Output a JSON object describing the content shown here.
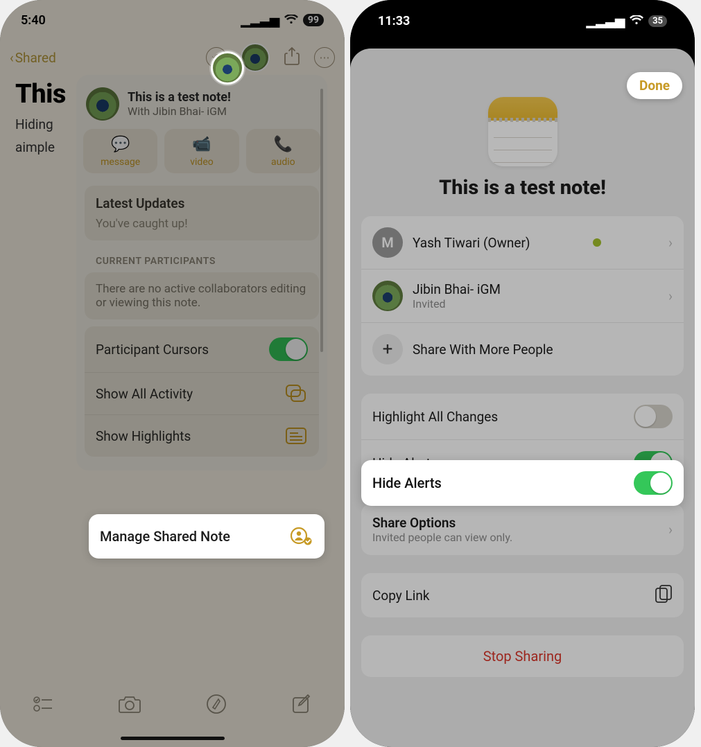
{
  "left": {
    "status": {
      "time": "5:40",
      "battery": "99"
    },
    "nav": {
      "back_label": "Shared"
    },
    "note": {
      "title_visible": "This",
      "line1": "Hiding",
      "line2": "aimple"
    },
    "popover": {
      "title": "This is a test note!",
      "subtitle": "With Jibin Bhai- iGM",
      "contacts": {
        "message": "message",
        "video": "video",
        "audio": "audio"
      },
      "updates": {
        "heading": "Latest Updates",
        "text": "You've caught up!"
      },
      "participants": {
        "label": "CURRENT PARTICIPANTS",
        "text": "There are no active collaborators editing or viewing this note."
      },
      "rows": {
        "cursors": "Participant Cursors",
        "activity": "Show All Activity",
        "highlights": "Show Highlights",
        "manage": "Manage Shared Note"
      }
    }
  },
  "right": {
    "status": {
      "time": "11:33",
      "battery": "35"
    },
    "done": "Done",
    "title": "This is a test note!",
    "people": {
      "owner": {
        "initial": "M",
        "name": "Yash Tiwari (Owner)"
      },
      "invited": {
        "name": "Jibin Bhai- iGM",
        "status": "Invited"
      },
      "add": "Share With More People"
    },
    "settings": {
      "highlight_changes": "Highlight All Changes",
      "hide_alerts": "Hide Alerts"
    },
    "share_options": {
      "title": "Share Options",
      "subtitle": "Invited people can view only."
    },
    "copy_link": "Copy Link",
    "stop_sharing": "Stop Sharing"
  }
}
